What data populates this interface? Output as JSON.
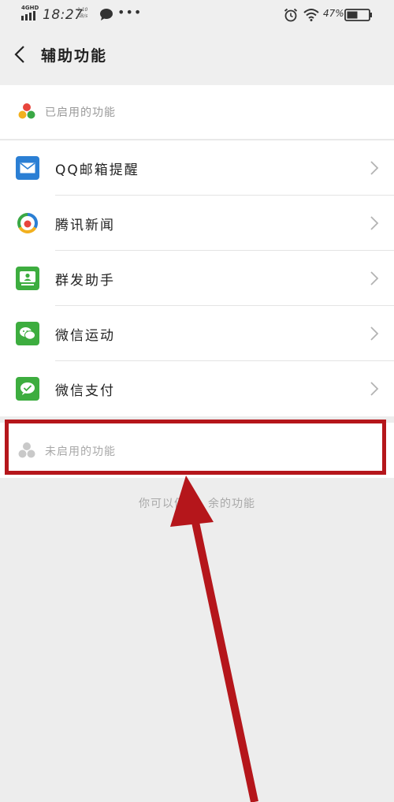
{
  "status_bar": {
    "network": "4GHD",
    "time": "18:27",
    "speed_value": "1.10",
    "speed_unit": "KB/s",
    "battery": "47%"
  },
  "header": {
    "title": "辅助功能"
  },
  "enabled_section": {
    "label": "已启用的功能",
    "items": [
      {
        "label": "QQ邮箱提醒",
        "icon": "mail-icon",
        "color": "#2b7fd4"
      },
      {
        "label": "腾讯新闻",
        "icon": "tencent-news-icon",
        "color": "#ffffff"
      },
      {
        "label": "群发助手",
        "icon": "mass-send-icon",
        "color": "#3dad3f"
      },
      {
        "label": "微信运动",
        "icon": "wechat-sport-icon",
        "color": "#3dad3f"
      },
      {
        "label": "微信支付",
        "icon": "wechat-pay-icon",
        "color": "#3dad3f"
      }
    ]
  },
  "disabled_section": {
    "label": "未启用的功能",
    "hint_left": "你可以停",
    "hint_right": "余的功能"
  },
  "annotation_color": "#b5161b"
}
